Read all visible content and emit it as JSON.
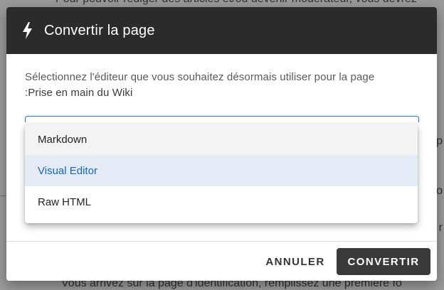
{
  "background": {
    "top_text": "Pour pouvoir rédiger des articles et/ou devenir modérateur, vous devrez",
    "bottom_text": "Vous arrivez sur la page d'identification, remplissez une première fo"
  },
  "dialog": {
    "icon": "bolt-icon",
    "title": "Convertir la page",
    "description": "Sélectionnez l'éditeur que vous souhaitez désormais utiliser pour la page",
    "page_name": ":Prise en main du Wiki",
    "options": [
      "Markdown",
      "Visual Editor",
      "Raw HTML"
    ],
    "selected_option": "Visual Editor",
    "cancel_label": "ANNULER",
    "convert_label": "CONVERTIR"
  },
  "colors": {
    "header_bg": "#2b2b2b",
    "accent": "#1976d2",
    "selected_bg": "#e4ebf7",
    "primary_button_bg": "#3a3a3a"
  }
}
